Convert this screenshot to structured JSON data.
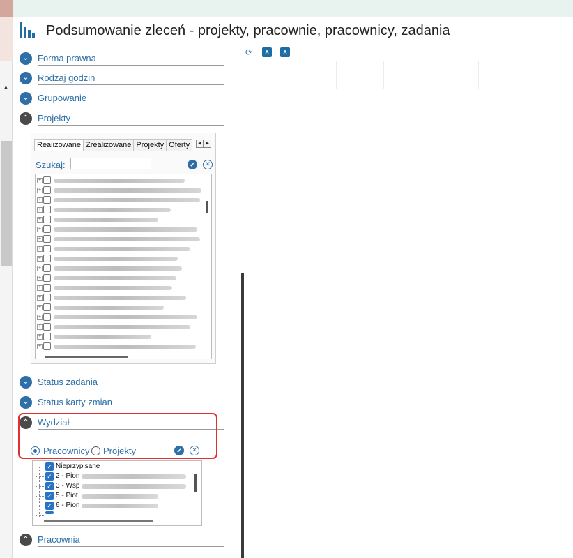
{
  "header": {
    "title": "Podsumowanie zleceń - projekty, pracownie, pracownicy, zadania"
  },
  "sections": {
    "forma_prawna": "Forma prawna",
    "rodzaj_godzin": "Rodzaj godzin",
    "grupowanie": "Grupowanie",
    "projekty": "Projekty",
    "status_zadania": "Status zadania",
    "status_karty_zmian": "Status karty zmian",
    "wydzial": "Wydział",
    "pracownia": "Pracownia"
  },
  "projekty_panel": {
    "tabs": [
      "Realizowane",
      "Zrealizowane",
      "Projekty",
      "Oferty"
    ],
    "search_label": "Szukaj:",
    "search_value": ""
  },
  "wydzial_panel": {
    "radio_pracownicy": "Pracownicy",
    "radio_projekty": "Projekty",
    "selected": "Pracownicy",
    "items": [
      "Nieprzypisane",
      "2 - Pion",
      "3 - Wsp",
      "5 - Piot",
      "6 - Pion"
    ]
  },
  "colors": {
    "accent": "#2d6fa6",
    "highlight": "#e03030",
    "header_band": "#e8f2ef"
  },
  "icons": {
    "refresh": "refresh-icon",
    "excel": "excel-icon",
    "check": "check-circle-icon",
    "clear": "clear-circle-icon",
    "expand": "chevron-down-icon",
    "collapse": "chevron-up-icon"
  }
}
